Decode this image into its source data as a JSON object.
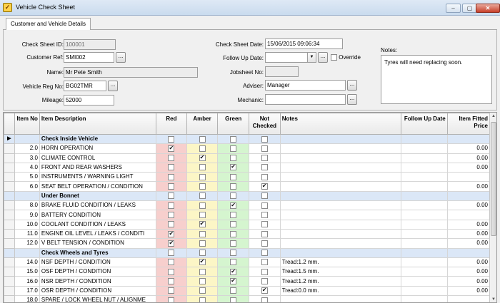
{
  "window": {
    "title": "Vehicle Check Sheet",
    "minimize": "–",
    "maximize": "▢",
    "close": "✕"
  },
  "tabs": [
    {
      "label": "Customer and Vehicle Details"
    }
  ],
  "form": {
    "check_sheet_id": {
      "label": "Check Sheet ID:",
      "value": "100001"
    },
    "customer_ref": {
      "label": "Customer Ref:",
      "value": "SMI002"
    },
    "name": {
      "label": "Name:",
      "value": "Mr Pete Smith"
    },
    "vehicle_reg": {
      "label": "Vehicle Reg No:",
      "value": "BG02TMR"
    },
    "mileage": {
      "label": "Mileage:",
      "value": "52000"
    },
    "check_sheet_date": {
      "label": "Check Sheet Date:",
      "value": "15/06/2015 09:06:34"
    },
    "follow_up_date": {
      "label": "Follow Up Date:",
      "value": ""
    },
    "override": {
      "label": "Override",
      "checked": false
    },
    "jobsheet_no": {
      "label": "Jobsheet No:",
      "value": ""
    },
    "adviser": {
      "label": "Adviser:",
      "value": "Manager"
    },
    "mechanic": {
      "label": "Mechanic:",
      "value": ""
    },
    "notes": {
      "label": "Notes:",
      "value": "Tyres will need replacing soon."
    },
    "dots": "..."
  },
  "grid": {
    "columns": {
      "item_no": "Item No",
      "desc": "Item Description",
      "red": "Red",
      "amber": "Amber",
      "green": "Green",
      "not_checked": "Not Checked",
      "notes": "Notes",
      "follow_up": "Follow Up Date",
      "price": "Item Fitted Price"
    },
    "row_indicator": "▶",
    "rows": [
      {
        "no": "",
        "desc": "Check Inside Vehicle",
        "section": true,
        "red": false,
        "amber": false,
        "green": false,
        "nc": false,
        "notes": "",
        "follow": "",
        "price": ""
      },
      {
        "no": "2.0",
        "desc": "HORN OPERATION",
        "section": false,
        "red": true,
        "amber": false,
        "green": false,
        "nc": false,
        "notes": "",
        "follow": "",
        "price": "0.00"
      },
      {
        "no": "3.0",
        "desc": "CLIMATE CONTROL",
        "section": false,
        "red": false,
        "amber": true,
        "green": false,
        "nc": false,
        "notes": "",
        "follow": "",
        "price": "0.00"
      },
      {
        "no": "4.0",
        "desc": "FRONT AND REAR WASHERS",
        "section": false,
        "red": false,
        "amber": false,
        "green": true,
        "nc": false,
        "notes": "",
        "follow": "",
        "price": "0.00"
      },
      {
        "no": "5.0",
        "desc": "INSTRUMENTS / WARNING LIGHT",
        "section": false,
        "red": false,
        "amber": false,
        "green": false,
        "nc": false,
        "notes": "",
        "follow": "",
        "price": ""
      },
      {
        "no": "6.0",
        "desc": "SEAT BELT OPERATION / CONDITION",
        "section": false,
        "red": false,
        "amber": false,
        "green": false,
        "nc": true,
        "notes": "",
        "follow": "",
        "price": "0.00"
      },
      {
        "no": "",
        "desc": "Under Bonnet",
        "section": true,
        "red": false,
        "amber": false,
        "green": false,
        "nc": false,
        "notes": "",
        "follow": "",
        "price": ""
      },
      {
        "no": "8.0",
        "desc": "BRAKE FLUID CONDITION / LEAKS",
        "section": false,
        "red": false,
        "amber": false,
        "green": true,
        "nc": false,
        "notes": "",
        "follow": "",
        "price": "0.00"
      },
      {
        "no": "9.0",
        "desc": "BATTERY CONDITION",
        "section": false,
        "red": false,
        "amber": false,
        "green": false,
        "nc": false,
        "notes": "",
        "follow": "",
        "price": ""
      },
      {
        "no": "10.0",
        "desc": "COOLANT CONDITION / LEAKS",
        "section": false,
        "red": false,
        "amber": true,
        "green": false,
        "nc": false,
        "notes": "",
        "follow": "",
        "price": "0.00"
      },
      {
        "no": "11.0",
        "desc": "ENGINE OIL LEVEL / LEAKS / CONDITI",
        "section": false,
        "red": true,
        "amber": false,
        "green": false,
        "nc": false,
        "notes": "",
        "follow": "",
        "price": "0.00"
      },
      {
        "no": "12.0",
        "desc": "V BELT TENSION / CONDITION",
        "section": false,
        "red": true,
        "amber": false,
        "green": false,
        "nc": false,
        "notes": "",
        "follow": "",
        "price": "0.00"
      },
      {
        "no": "",
        "desc": "Check Wheels and Tyres",
        "section": true,
        "red": false,
        "amber": false,
        "green": false,
        "nc": false,
        "notes": "",
        "follow": "",
        "price": ""
      },
      {
        "no": "14.0",
        "desc": "NSF DEPTH / CONDITION",
        "section": false,
        "red": false,
        "amber": true,
        "green": false,
        "nc": false,
        "notes": "Tread:1.2 mm.",
        "follow": "",
        "price": "0.00"
      },
      {
        "no": "15.0",
        "desc": "OSF DEPTH / CONDITION",
        "section": false,
        "red": false,
        "amber": false,
        "green": true,
        "nc": false,
        "notes": "Tread:1.5 mm.",
        "follow": "",
        "price": "0.00"
      },
      {
        "no": "16.0",
        "desc": "NSR DEPTH / CONDITION",
        "section": false,
        "red": false,
        "amber": false,
        "green": true,
        "nc": false,
        "notes": "Tread:1.2 mm.",
        "follow": "",
        "price": "0.00"
      },
      {
        "no": "17.0",
        "desc": "OSR DEPTH / CONDITION",
        "section": false,
        "red": false,
        "amber": false,
        "green": false,
        "nc": true,
        "notes": "Tread:0.0 mm.",
        "follow": "",
        "price": "0.00"
      },
      {
        "no": "18.0",
        "desc": "SPARE / LOCK WHEEL NUT / ALIGNME",
        "section": false,
        "red": false,
        "amber": false,
        "green": false,
        "nc": false,
        "notes": "",
        "follow": "",
        "price": ""
      }
    ]
  },
  "scrollbar": {
    "up": "▲",
    "down": "▼"
  }
}
